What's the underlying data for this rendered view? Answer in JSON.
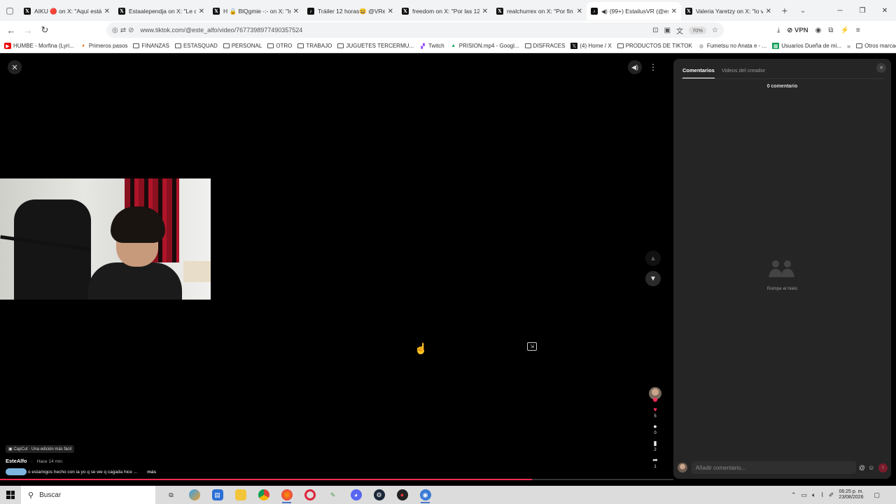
{
  "browser": {
    "tabs": [
      {
        "title": "AIKU 🔴 on X: \"Aquí está n",
        "icon": "x-icon",
        "active": false
      },
      {
        "title": "Estaalependja on X: \"Le car",
        "icon": "x-icon",
        "active": false
      },
      {
        "title": "H 🔒 BlQgmie -:- on X: \"In",
        "icon": "x-icon",
        "active": false
      },
      {
        "title": "Tráiler 12 horas😆 @VRenc",
        "icon": "tiktok-icon",
        "active": false
      },
      {
        "title": "freedom on X: \"Por las 12",
        "icon": "x-icon",
        "active": false
      },
      {
        "title": "realchurrex on X: \"Por fin a",
        "icon": "x-icon",
        "active": false
      },
      {
        "title": "(99+) EstailusVR (@esta",
        "icon": "tiktok-icon",
        "active": true
      },
      {
        "title": "Valeria Yaretzy on X: \"lo vol",
        "icon": "x-icon",
        "active": false
      }
    ],
    "url": "www.tiktok.com/@este_alfo/video/7677398977490357524",
    "zoom": "70%",
    "vpn_label": "VPN",
    "bookmarks": [
      {
        "label": "HUMBE - Morfina (Lyri...",
        "icon": "youtube-icon"
      },
      {
        "label": "Primeros pasos",
        "icon": "firefox-icon"
      },
      {
        "label": "FINANZAS",
        "icon": "folder-icon"
      },
      {
        "label": "ESTASQUAD",
        "icon": "folder-icon"
      },
      {
        "label": "PERSONAL",
        "icon": "folder-icon"
      },
      {
        "label": "OTRO",
        "icon": "folder-icon"
      },
      {
        "label": "TRABAJO",
        "icon": "folder-icon"
      },
      {
        "label": "JUGUETES TERCERMU...",
        "icon": "folder-icon"
      },
      {
        "label": "Twitch",
        "icon": "twitch-icon"
      },
      {
        "label": "PRISION.mp4 - Googl...",
        "icon": "drive-icon"
      },
      {
        "label": "DISFRACES",
        "icon": "folder-icon"
      },
      {
        "label": "(4) Home / X",
        "icon": "x-icon"
      },
      {
        "label": "PRODUCTOS DE TIKTOK",
        "icon": "folder-icon"
      },
      {
        "label": "Fumetsu no Anata e - ...",
        "icon": "globe-icon"
      },
      {
        "label": "Usuarios Dueña de mi...",
        "icon": "sheets-icon"
      }
    ],
    "other_bookmarks": "Otros marcadores"
  },
  "video": {
    "capcut_badge": "CapCut · Una edición más fácil",
    "author": "EsteAlfo",
    "posted": "Hace 14 min",
    "description": "o estamigos hecho con ia yo q se we q cagada hice ...",
    "more_label": "más",
    "counts": {
      "likes": "5",
      "comments": "0",
      "saves": "2",
      "shares": "1"
    },
    "progress": 0.79
  },
  "comments_panel": {
    "tab_comments": "Comentarios",
    "tab_creator_videos": "Videos del creador",
    "count_label": "0 comentario",
    "empty_label": "Rompe el hielo",
    "input_placeholder": "Añadir comentario..."
  },
  "taskbar": {
    "search_placeholder": "Buscar",
    "time": "06:25 p. m.",
    "date": "23/08/2026"
  }
}
